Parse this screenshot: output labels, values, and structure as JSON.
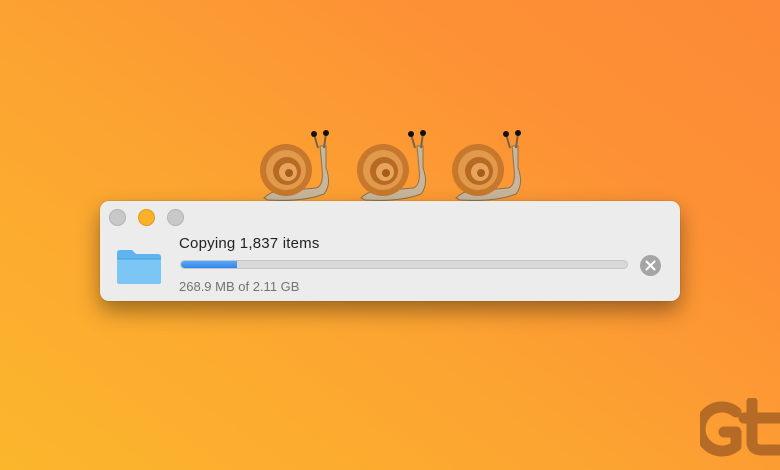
{
  "decoration": {
    "snails": [
      "snail-emoji",
      "snail-emoji",
      "snail-emoji"
    ]
  },
  "dialog": {
    "title": "Copying 1,837 items",
    "status": "268.9 MB of 2.11 GB",
    "progress_fraction": 0.125,
    "icons": {
      "folder": "folder-icon",
      "cancel": "cancel-icon"
    },
    "colors": {
      "progress": "#2f86ee",
      "minimize": "#fbb22a"
    }
  },
  "brand": {
    "logo": "Gt",
    "color": "#b56a26"
  }
}
